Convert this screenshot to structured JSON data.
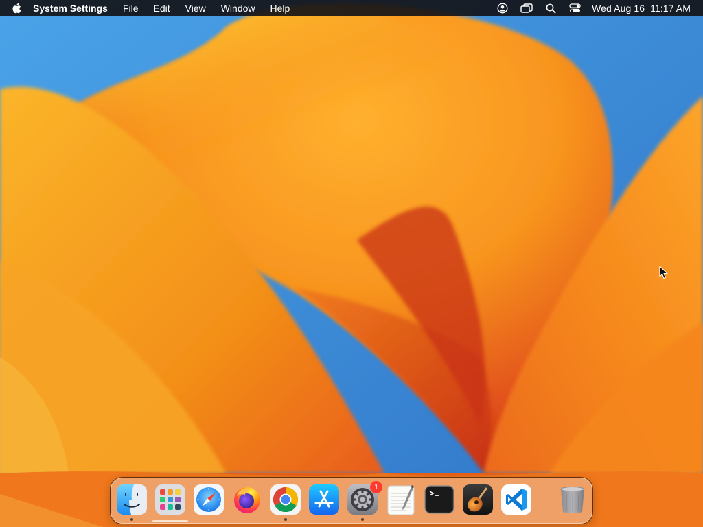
{
  "menubar": {
    "apple_icon": "apple-logo-icon",
    "app_name": "System Settings",
    "menus": [
      "File",
      "Edit",
      "View",
      "Window",
      "Help"
    ],
    "status_icons": [
      "user-account-icon",
      "screen-mirroring-icon",
      "spotlight-search-icon",
      "control-center-icon"
    ],
    "clock": "Wed Aug 16  11:17 AM"
  },
  "dock": {
    "apps": [
      {
        "name": "Finder",
        "icon": "finder-icon",
        "running": true
      },
      {
        "name": "Launchpad",
        "icon": "launchpad-icon",
        "running": false
      },
      {
        "name": "Safari",
        "icon": "safari-icon",
        "running": false
      },
      {
        "name": "Firefox",
        "icon": "firefox-icon",
        "running": false
      },
      {
        "name": "Google Chrome",
        "icon": "chrome-icon",
        "running": true
      },
      {
        "name": "App Store",
        "icon": "app-store-icon",
        "running": false
      },
      {
        "name": "System Settings",
        "icon": "system-settings-icon",
        "running": true,
        "badge": "1"
      },
      {
        "name": "TextEdit",
        "icon": "textedit-icon",
        "running": false
      },
      {
        "name": "Terminal",
        "icon": "terminal-icon",
        "running": false
      },
      {
        "name": "GarageBand",
        "icon": "garageband-icon",
        "running": false
      },
      {
        "name": "Visual Studio Code",
        "icon": "vscode-icon",
        "running": false
      }
    ],
    "trash": {
      "name": "Trash",
      "icon": "trash-icon"
    }
  },
  "colors": {
    "menubar_bg": "#141418",
    "wallpaper_orange": "#f7941d",
    "wallpaper_yellow": "#fcd34d",
    "wallpaper_red": "#d9361c",
    "wallpaper_blue": "#3f8fd8",
    "badge": "#ff3b30"
  }
}
